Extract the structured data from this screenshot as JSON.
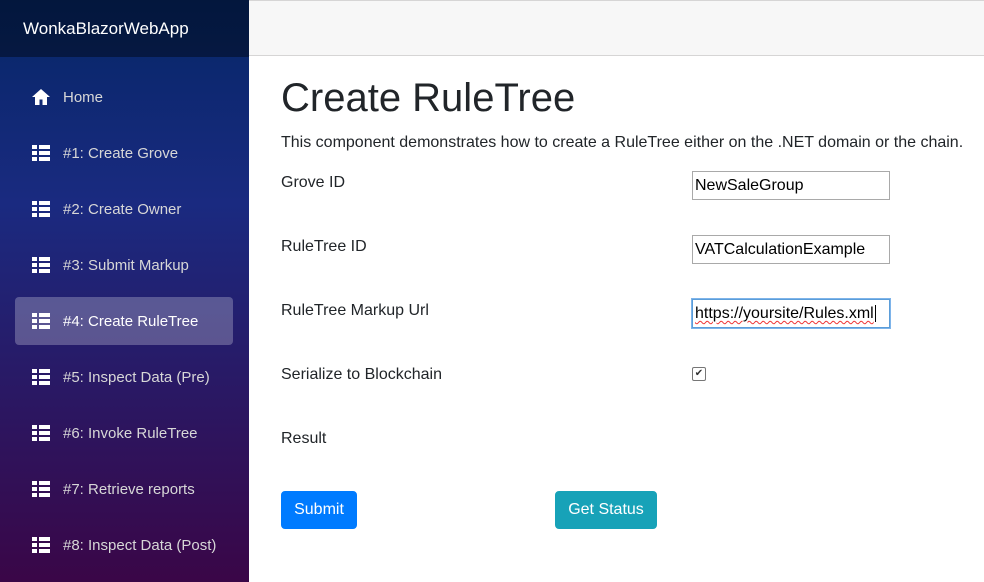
{
  "app": {
    "title": "WonkaBlazorWebApp"
  },
  "sidebar": {
    "items": [
      {
        "label": "Home",
        "icon": "home-icon",
        "active": false
      },
      {
        "label": "#1: Create Grove",
        "icon": "list-icon",
        "active": false
      },
      {
        "label": "#2: Create Owner",
        "icon": "list-icon",
        "active": false
      },
      {
        "label": "#3: Submit Markup",
        "icon": "list-icon",
        "active": false
      },
      {
        "label": "#4: Create RuleTree",
        "icon": "list-icon",
        "active": true
      },
      {
        "label": "#5: Inspect Data (Pre)",
        "icon": "list-icon",
        "active": false
      },
      {
        "label": "#6: Invoke RuleTree",
        "icon": "list-icon",
        "active": false
      },
      {
        "label": "#7: Retrieve reports",
        "icon": "list-icon",
        "active": false
      },
      {
        "label": "#8: Inspect Data (Post)",
        "icon": "list-icon",
        "active": false
      }
    ]
  },
  "page": {
    "title": "Create RuleTree",
    "description": "This component demonstrates how to create a RuleTree either on the .NET domain or the chain.",
    "form": {
      "grove_id": {
        "label": "Grove ID",
        "value": "NewSaleGroup"
      },
      "ruletree_id": {
        "label": "RuleTree ID",
        "value": "VATCalculationExample"
      },
      "markup_url": {
        "label": "RuleTree Markup Url",
        "value": "https://yoursite/Rules.xml"
      },
      "serialize": {
        "label": "Serialize to Blockchain",
        "checked": true
      },
      "result": {
        "label": "Result"
      }
    },
    "buttons": {
      "submit": "Submit",
      "get_status": "Get Status"
    }
  },
  "colors": {
    "primary": "#007bff",
    "info": "#17a2b8",
    "sidebar_top": "#052767",
    "sidebar_bottom": "#3a0647"
  }
}
